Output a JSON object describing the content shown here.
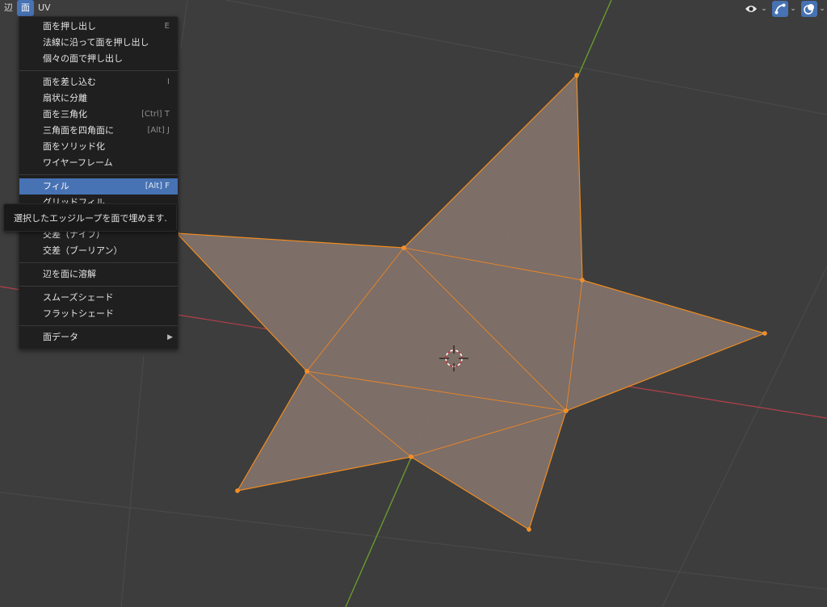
{
  "menubar": {
    "items": [
      {
        "label": "辺",
        "active": false
      },
      {
        "label": "面",
        "active": true
      },
      {
        "label": "UV",
        "active": false
      }
    ]
  },
  "face_menu": {
    "extrude_faces": {
      "label": "面を押し出し",
      "shortcut": "E"
    },
    "extrude_normals": {
      "label": "法線に沿って面を押し出し"
    },
    "extrude_individual": {
      "label": "個々の面で押し出し"
    },
    "inset_faces": {
      "label": "面を差し込む",
      "shortcut": "I"
    },
    "poke_faces": {
      "label": "扇状に分離"
    },
    "triangulate": {
      "label": "面を三角化",
      "shortcut": "[Ctrl] T"
    },
    "tris_to_quads": {
      "label": "三角面を四角面に",
      "shortcut": "[Alt] J"
    },
    "solidify": {
      "label": "面をソリッド化"
    },
    "wireframe": {
      "label": "ワイヤーフレーム"
    },
    "fill": {
      "label": "フィル",
      "shortcut": "[Alt] F"
    },
    "grid_fill": {
      "label": "グリッドフィル"
    },
    "intersect_knife": {
      "label": "交差（ナイフ）"
    },
    "intersect_boolean": {
      "label": "交差（ブーリアン）"
    },
    "dissolve_edges": {
      "label": "辺を面に溶解"
    },
    "shade_smooth": {
      "label": "スムーズシェード"
    },
    "shade_flat": {
      "label": "フラットシェード"
    },
    "face_data": {
      "label": "面データ"
    }
  },
  "tooltip": {
    "text": "選択したエッジループを面で埋めます."
  },
  "header_icons": {
    "visibility": "eye-icon",
    "gizmo": "gizmo-icon",
    "overlay": "overlay-icon"
  },
  "colors": {
    "highlight": "#4772b3",
    "menu_bg": "#1f1f1f",
    "viewport_bg": "#3d3d3d",
    "mesh_face": "#7f7068",
    "mesh_edge": "#f28c1e",
    "x_axis": "#b4404a",
    "y_axis": "#6a9a2e"
  }
}
